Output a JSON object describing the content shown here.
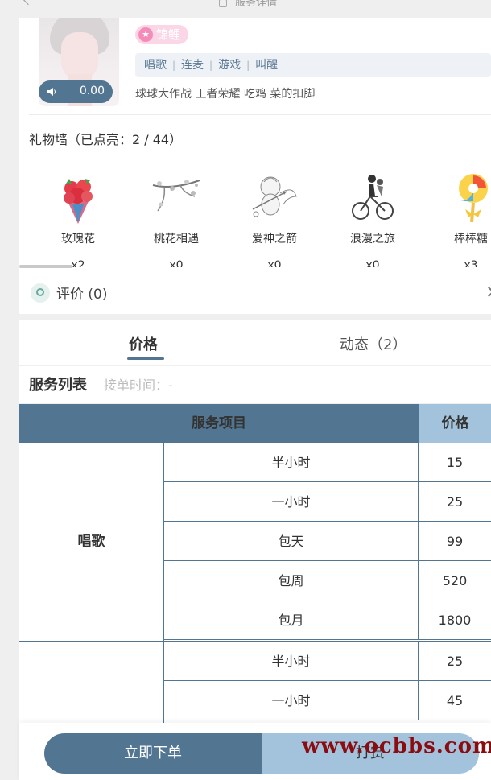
{
  "header": {
    "title": "服务详情",
    "more": "···"
  },
  "profile": {
    "voice_value": "0.00",
    "badge": "锦鲤",
    "tags": [
      "唱歌",
      "连麦",
      "游戏",
      "叫醒"
    ],
    "games": "球球大作战 王者荣耀 吃鸡 菜的扣脚"
  },
  "gift_wall": {
    "title": "礼物墙（已点亮：2 / 44）",
    "gifts": [
      {
        "name": "玫瑰花",
        "count": "x2",
        "icon": "rose-bouquet-icon"
      },
      {
        "name": "桃花相遇",
        "count": "x0",
        "icon": "peach-blossom-icon"
      },
      {
        "name": "爱神之箭",
        "count": "x0",
        "icon": "cupid-icon"
      },
      {
        "name": "浪漫之旅",
        "count": "x0",
        "icon": "bicycle-couple-icon"
      },
      {
        "name": "棒棒糖",
        "count": "x3",
        "icon": "lollipop-icon"
      }
    ]
  },
  "review": {
    "label": "评价 (0)"
  },
  "tabs": [
    {
      "label": "价格"
    },
    {
      "label": "动态（2）"
    }
  ],
  "services": {
    "title": "服务列表",
    "accept_time": "接单时间：-",
    "col_item": "服务项目",
    "col_price": "价格",
    "groups": [
      {
        "name": "唱歌",
        "rows": [
          {
            "duration": "半小时",
            "price": "15"
          },
          {
            "duration": "一小时",
            "price": "25"
          },
          {
            "duration": "包天",
            "price": "99"
          },
          {
            "duration": "包周",
            "price": "520"
          },
          {
            "duration": "包月",
            "price": "1800"
          }
        ]
      },
      {
        "name": "",
        "rows": [
          {
            "duration": "半小时",
            "price": "25"
          },
          {
            "duration": "一小时",
            "price": "45"
          }
        ]
      }
    ]
  },
  "actions": {
    "order": "立即下单",
    "tip": "打赏"
  },
  "watermark": "www.ocbbs.com",
  "colors": {
    "primary": "#527592",
    "secondary": "#a3c3dc",
    "badge": "#fbd6e6"
  }
}
